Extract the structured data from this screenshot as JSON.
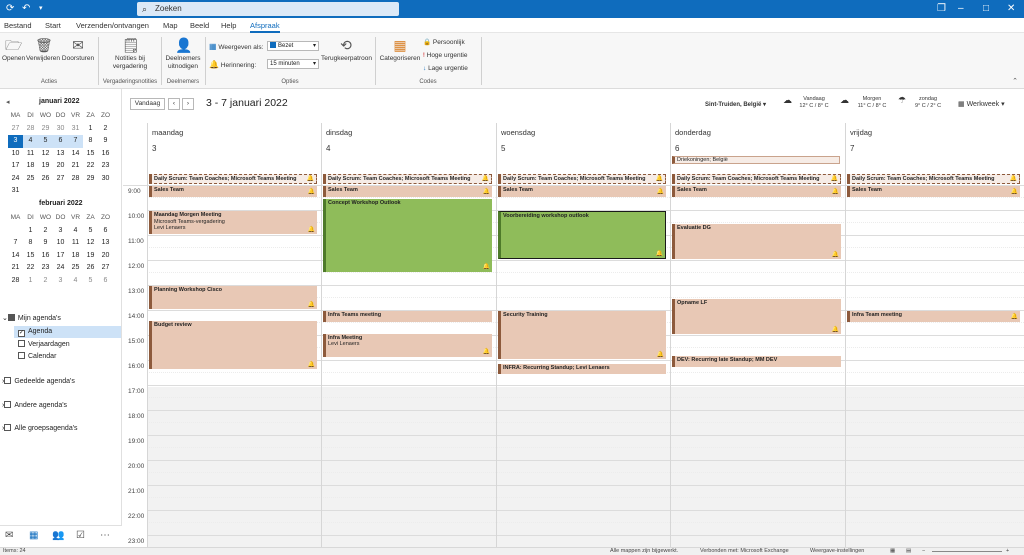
{
  "titlebar": {
    "search_placeholder": "Zoeken"
  },
  "menu": [
    "Bestand",
    "Start",
    "Verzenden/ontvangen",
    "Map",
    "Beeld",
    "Help",
    "Afspraak"
  ],
  "ribbon": {
    "open": "Openen",
    "delete": "Verwijderen",
    "forward": "Doorsturen",
    "group_actions": "Acties",
    "notes": "Notities bij vergadering",
    "group_notes": "Vergaderingsnotities",
    "invite": "Deelnemers uitnodigen",
    "group_attendees": "Deelnemers",
    "show_as_label": "Weergeven als:",
    "show_as_value": "Bezet",
    "reminder_label": "Herinnering:",
    "reminder_value": "15 minuten",
    "recurrence": "Terugkeerpatroon",
    "group_options": "Opties",
    "categorize": "Categoriseren",
    "private": "Persoonlijk",
    "high": "Hoge urgentie",
    "low": "Lage urgentie",
    "group_codes": "Codes"
  },
  "minical": {
    "headers": [
      "MA",
      "DI",
      "WO",
      "DO",
      "VR",
      "ZA",
      "ZO"
    ],
    "jan": {
      "title": "januari 2022",
      "days": [
        "27",
        "28",
        "29",
        "30",
        "31",
        "1",
        "2",
        "3",
        "4",
        "5",
        "6",
        "7",
        "8",
        "9",
        "10",
        "11",
        "12",
        "13",
        "14",
        "15",
        "16",
        "17",
        "18",
        "19",
        "20",
        "21",
        "22",
        "23",
        "24",
        "25",
        "26",
        "27",
        "28",
        "29",
        "30",
        "31"
      ]
    },
    "feb": {
      "title": "februari 2022",
      "days": [
        "",
        "1",
        "2",
        "3",
        "4",
        "5",
        "6",
        "7",
        "8",
        "9",
        "10",
        "11",
        "12",
        "13",
        "14",
        "15",
        "16",
        "17",
        "18",
        "19",
        "20",
        "21",
        "22",
        "23",
        "24",
        "25",
        "26",
        "27",
        "28",
        "1",
        "2",
        "3",
        "4",
        "5",
        "6"
      ]
    }
  },
  "folders": {
    "my": "Mijn agenda's",
    "agenda": "Agenda",
    "birthdays": "Verjaardagen",
    "calendar": "Calendar",
    "shared": "Gedeelde agenda's",
    "other": "Andere agenda's",
    "groups": "Alle groepsagenda's"
  },
  "calhead": {
    "today": "Vandaag",
    "range": "3 - 7 januari 2022",
    "location": "Sint-Truiden, België",
    "weather": [
      {
        "day": "Vandaag",
        "temp": "12° C / 8° C"
      },
      {
        "day": "Morgen",
        "temp": "11° C / 8° C"
      },
      {
        "day": "zondag",
        "temp": "9° C / 2° C"
      }
    ],
    "view": "Werkweek"
  },
  "days": [
    {
      "name": "maandag",
      "num": "3"
    },
    {
      "name": "dinsdag",
      "num": "4"
    },
    {
      "name": "woensdag",
      "num": "5"
    },
    {
      "name": "donderdag",
      "num": "6"
    },
    {
      "name": "vrijdag",
      "num": "7"
    }
  ],
  "hours": [
    "9:00",
    "10:00",
    "11:00",
    "12:00",
    "13:00",
    "14:00",
    "15:00",
    "16:00",
    "17:00",
    "18:00",
    "19:00",
    "20:00",
    "21:00",
    "22:00",
    "23:00"
  ],
  "allday": {
    "text": "Driekoningen; België"
  },
  "events": {
    "scrum": "Daily Scrum: Team Coaches; Microsoft Teams Meeting",
    "sales": "Sales Team",
    "mon_morgen_title": "Maandag Morgen Meeting",
    "mon_morgen_l1": "Microsoft Teams-vergadering",
    "mon_morgen_l2": "Levi Lenaers",
    "planning": "Planning Workshop Cisco",
    "budget": "Budget review",
    "concept": "Concept Workshop Outlook",
    "infra": "Infra Teams meeting",
    "infra_meeting": "Infra Meeting",
    "infra_meeting_l": "Levi Lenaers",
    "voorbereiding": "Voorbereiding workshop outlook",
    "security": "Security Training",
    "standup": "INFRA: Recurring  Standup; Levi Lenaers",
    "evaluatie": "Evaluatie DG",
    "opname": "Opname LF",
    "dev": "DEV: Recurring late Standup; MM DEV",
    "fri_infra": "Infra Team meeting"
  },
  "status": {
    "items": "Items: 24",
    "folders": "Alle mappen zijn bijgewerkt.",
    "connected": "Verbonden met: Microsoft Exchange",
    "display": "Weergave-instellingen"
  },
  "colors": {
    "accent": "#0f6cbd",
    "event": "#e8c8b5",
    "event_border": "#8d5a3c",
    "green": "#8fbc5a"
  }
}
